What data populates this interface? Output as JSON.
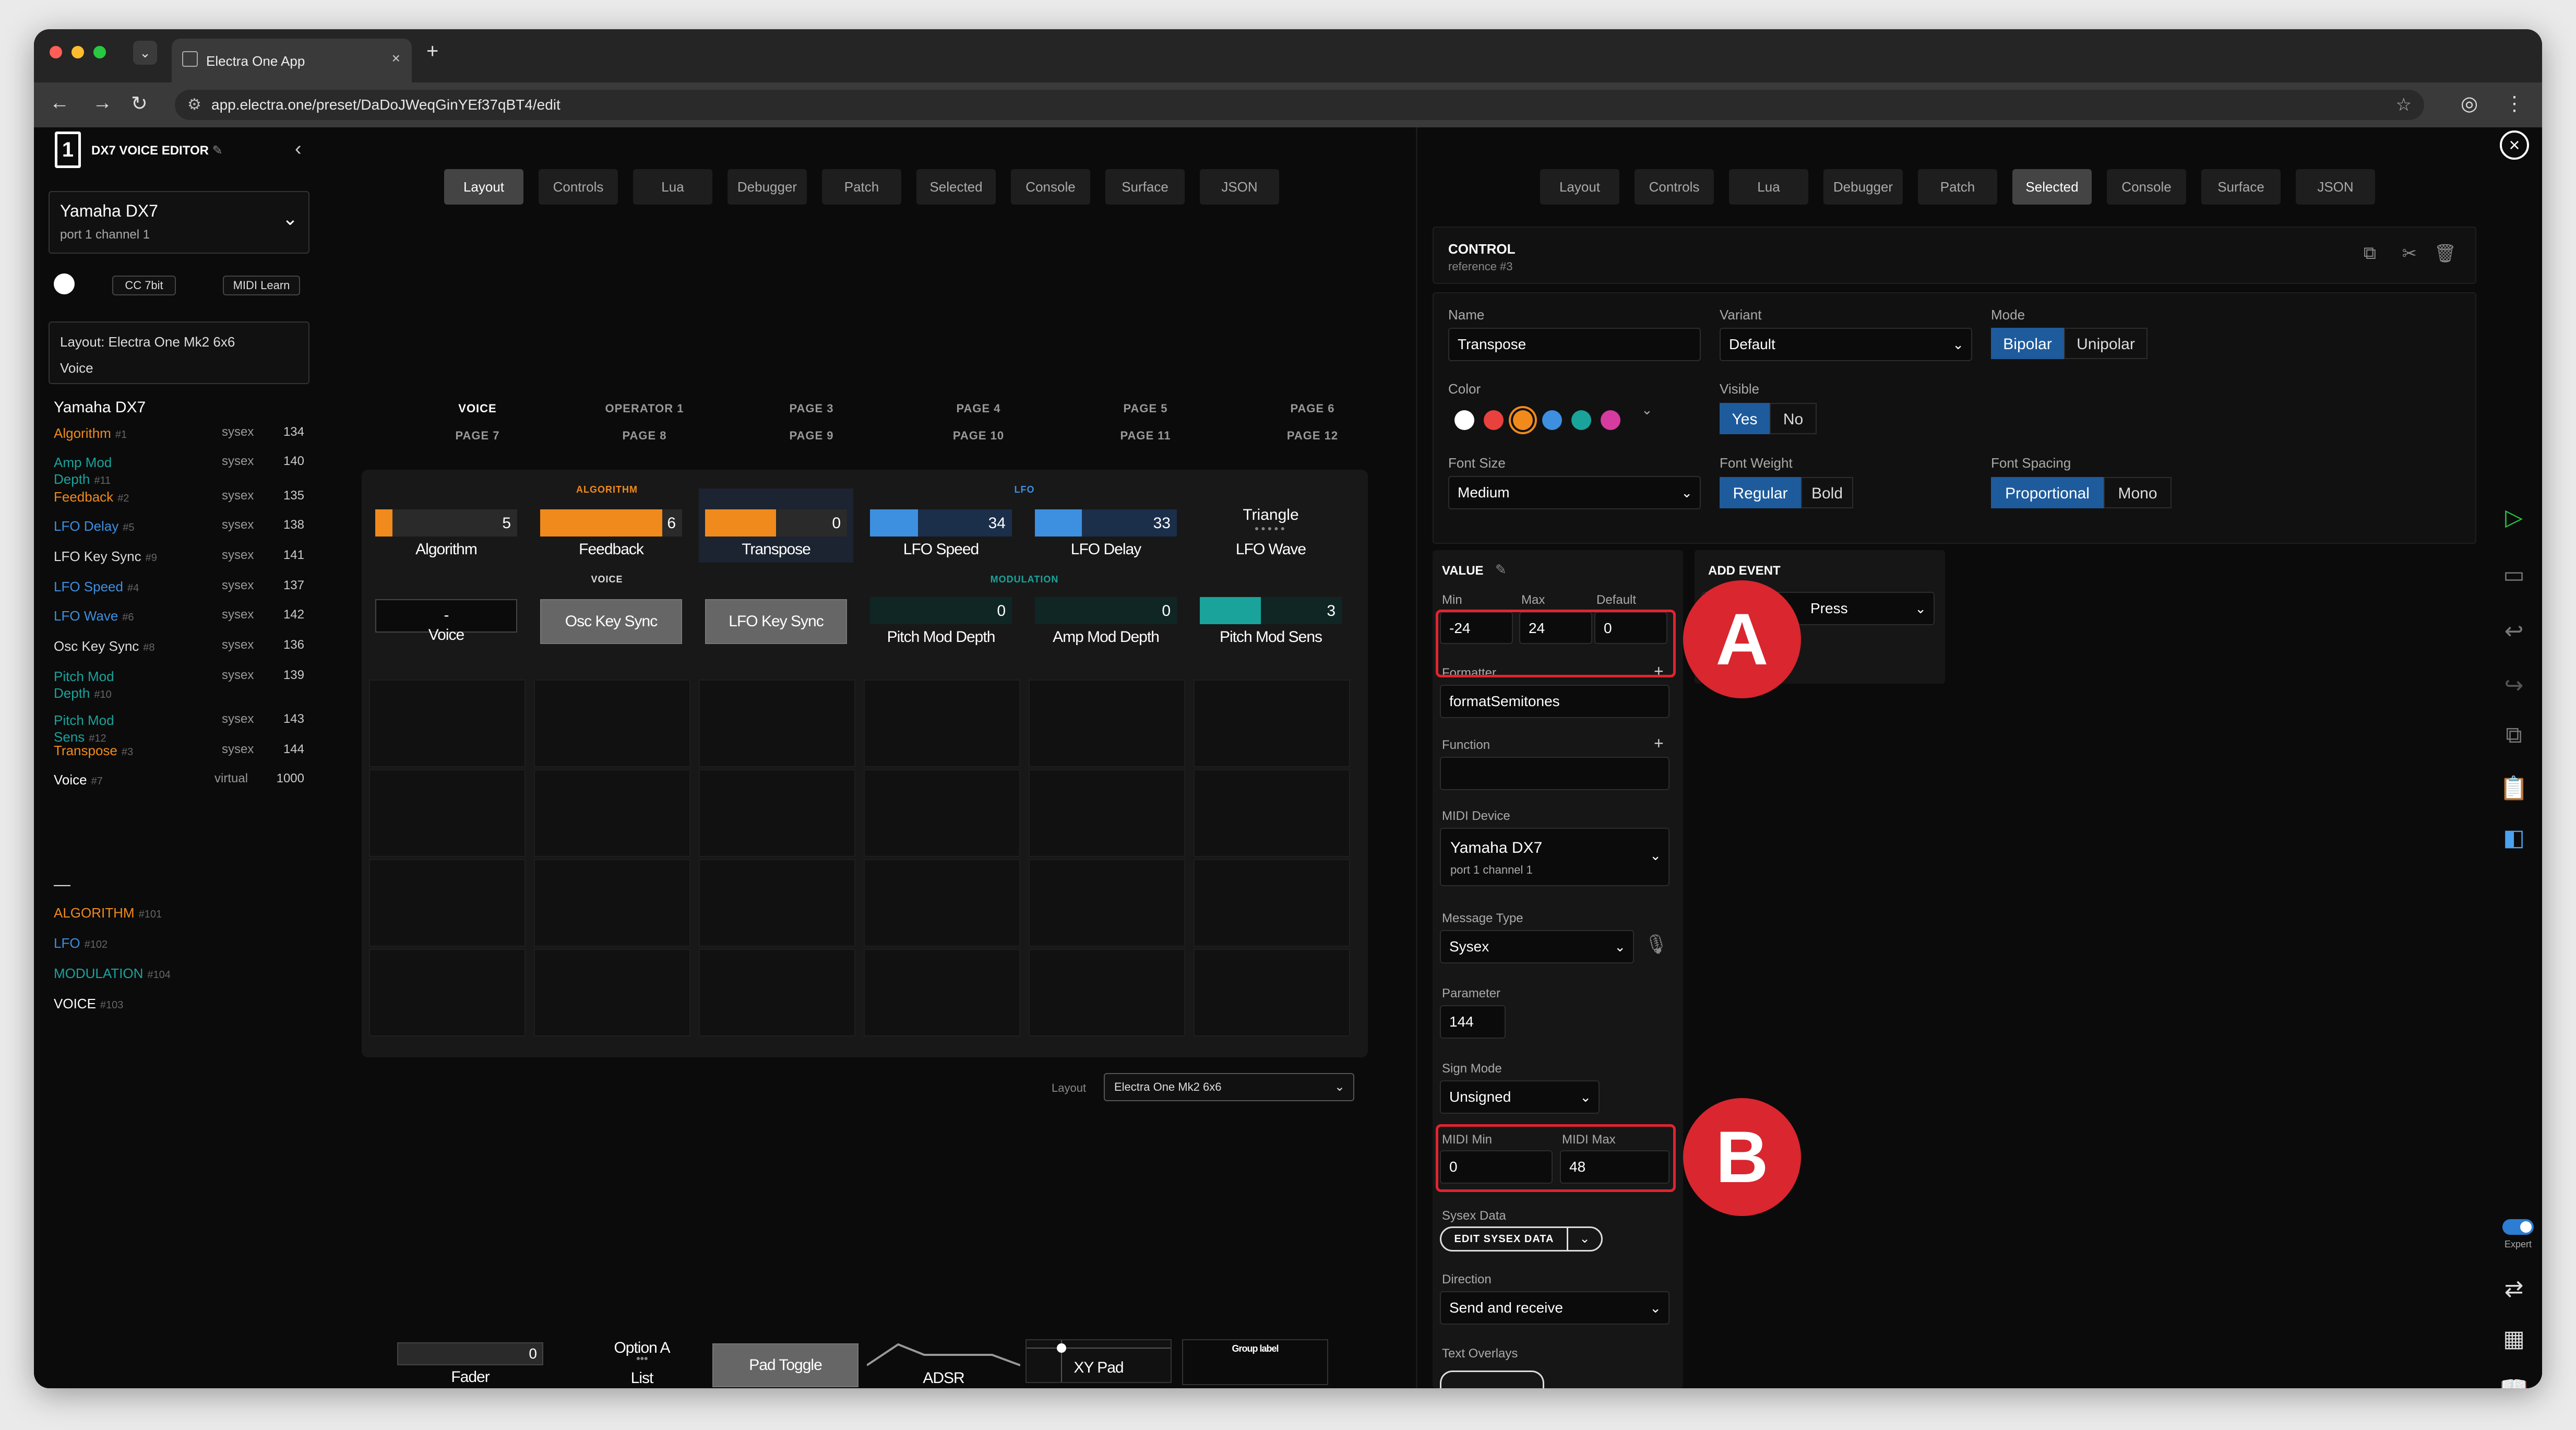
{
  "browser": {
    "tab_title": "Electra One App",
    "tab_close": "×",
    "new_tab": "+",
    "url": "app.electra.one/preset/DaDoJWeqGinYEf37qBT4/edit",
    "tune_icon": "⚙",
    "star_icon": "☆",
    "profile_icon": "◎",
    "menu_icon": "⋮",
    "back_icon": "←",
    "forward_icon": "→",
    "reload_icon": "↻",
    "tab_dropdown": "⌄"
  },
  "sidebar": {
    "logo": "1",
    "title": "DX7 VOICE EDITOR",
    "edit_icon": "✎",
    "collapse_icon": "‹",
    "device_name": "Yamaha DX7",
    "device_port": "port 1 channel 1",
    "device_chevron": "⌄",
    "cc_label": "CC 7bit",
    "midi_learn_label": "MIDI Learn",
    "layout_label": "Layout: Electra One Mk2 6x6",
    "layout_sub": "Voice",
    "controls_title": "Yamaha DX7",
    "controls": [
      {
        "name": "Algorithm",
        "ref": "#1",
        "type": "sysex",
        "param": "134",
        "color": "#f08a1c"
      },
      {
        "name": "Amp Mod Depth",
        "ref": "#11",
        "type": "sysex",
        "param": "140",
        "color": "#1aa39b"
      },
      {
        "name": "Feedback",
        "ref": "#2",
        "type": "sysex",
        "param": "135",
        "color": "#f08a1c"
      },
      {
        "name": "LFO Delay",
        "ref": "#5",
        "type": "sysex",
        "param": "138",
        "color": "#3d8fe0"
      },
      {
        "name": "LFO Key Sync",
        "ref": "#9",
        "type": "sysex",
        "param": "141",
        "color": "#dddddd"
      },
      {
        "name": "LFO Speed",
        "ref": "#4",
        "type": "sysex",
        "param": "137",
        "color": "#3d8fe0"
      },
      {
        "name": "LFO Wave",
        "ref": "#6",
        "type": "sysex",
        "param": "142",
        "color": "#3d8fe0"
      },
      {
        "name": "Osc Key Sync",
        "ref": "#8",
        "type": "sysex",
        "param": "136",
        "color": "#dddddd"
      },
      {
        "name": "Pitch Mod Depth",
        "ref": "#10",
        "type": "sysex",
        "param": "139",
        "color": "#1aa39b"
      },
      {
        "name": "Pitch Mod Sens",
        "ref": "#12",
        "type": "sysex",
        "param": "143",
        "color": "#1aa39b"
      },
      {
        "name": "Transpose",
        "ref": "#3",
        "type": "sysex",
        "param": "144",
        "color": "#f08a1c"
      },
      {
        "name": "Voice",
        "ref": "#7",
        "type": "virtual",
        "param": "1000",
        "color": "#ffffff"
      }
    ],
    "separator": "—",
    "groups": [
      {
        "name": "ALGORITHM",
        "ref": "#101",
        "color": "#f08a1c"
      },
      {
        "name": "LFO",
        "ref": "#102",
        "color": "#3d8fe0"
      },
      {
        "name": "MODULATION",
        "ref": "#104",
        "color": "#1aa39b"
      },
      {
        "name": "VOICE",
        "ref": "#103",
        "color": "#ffffff"
      }
    ]
  },
  "tabs": [
    "Layout",
    "Controls",
    "Lua",
    "Debugger",
    "Patch",
    "Selected",
    "Console",
    "Surface",
    "JSON"
  ],
  "left_active_tab": "Layout",
  "right_active_tab": "Selected",
  "pages_row1": [
    "VOICE",
    "OPERATOR 1",
    "PAGE 3",
    "PAGE 4",
    "PAGE 5",
    "PAGE 6"
  ],
  "pages_row2": [
    "PAGE 7",
    "PAGE 8",
    "PAGE 9",
    "PAGE 10",
    "PAGE 11",
    "PAGE 12"
  ],
  "device_groups": {
    "algorithm": "ALGORITHM",
    "lfo": "LFO",
    "voice": "VOICE",
    "modulation": "MODULATION"
  },
  "device_controls": {
    "algorithm": {
      "label": "Algorithm",
      "value": "5",
      "level": 0.12
    },
    "feedback": {
      "label": "Feedback",
      "value": "6",
      "level": 0.86
    },
    "transpose": {
      "label": "Transpose",
      "value": "0",
      "level": 0.5
    },
    "lfo_speed": {
      "label": "LFO Speed",
      "value": "34",
      "level": 0.34
    },
    "lfo_delay": {
      "label": "LFO Delay",
      "value": "33",
      "level": 0.33
    },
    "lfo_wave": {
      "label": "LFO Wave",
      "value": "Triangle"
    },
    "voice": {
      "label": "Voice",
      "value": "-"
    },
    "osc_key_sync": {
      "label": "Osc Key Sync"
    },
    "lfo_key_sync": {
      "label": "LFO Key Sync"
    },
    "pitch_mod_depth": {
      "label": "Pitch Mod Depth",
      "value": "0"
    },
    "amp_mod_depth": {
      "label": "Amp Mod Depth",
      "value": "0"
    },
    "pitch_mod_sens": {
      "label": "Pitch Mod Sens",
      "value": "3",
      "level": 0.43
    }
  },
  "layout_select": {
    "label": "Layout",
    "value": "Electra One Mk2 6x6"
  },
  "palette": {
    "fader": {
      "label": "Fader",
      "value": "0"
    },
    "option": {
      "label": "List",
      "value": "Option A"
    },
    "pad_toggle": {
      "label": "Pad Toggle"
    },
    "adsr": {
      "label": "ADSR"
    },
    "xy_pad": {
      "label": "XY Pad"
    },
    "group_label": {
      "label": "Group label"
    }
  },
  "control_panel": {
    "title": "CONTROL",
    "subtitle": "reference #3",
    "close_icon": "×",
    "name_label": "Name",
    "name_value": "Transpose",
    "variant_label": "Variant",
    "variant_value": "Default",
    "mode_label": "Mode",
    "mode_options": [
      "Bipolar",
      "Unipolar"
    ],
    "mode_selected": "Bipolar",
    "color_label": "Color",
    "colors": [
      "#ffffff",
      "#e8413e",
      "#f08a1c",
      "#3d8fe0",
      "#1aa39b",
      "#d63ba0"
    ],
    "selected_color": "#f08a1c",
    "visible_label": "Visible",
    "visible_options": [
      "Yes",
      "No"
    ],
    "visible_selected": "Yes",
    "font_size_label": "Font Size",
    "font_size_value": "Medium",
    "font_weight_label": "Font Weight",
    "font_weight_options": [
      "Regular",
      "Bold"
    ],
    "font_weight_selected": "Regular",
    "font_spacing_label": "Font Spacing",
    "font_spacing_options": [
      "Proportional",
      "Mono"
    ],
    "font_spacing_selected": "Proportional"
  },
  "value_panel": {
    "title": "VALUE",
    "min_label": "Min",
    "min_value": "-24",
    "max_label": "Max",
    "max_value": "24",
    "default_label": "Default",
    "default_value": "0",
    "formatter_label": "Formatter",
    "formatter_value": "formatSemitones",
    "function_label": "Function",
    "function_value": "",
    "midi_device_label": "MIDI Device",
    "midi_device_value": "Yamaha DX7",
    "midi_device_port": "port 1 channel 1",
    "message_type_label": "Message Type",
    "message_type_value": "Sysex",
    "parameter_label": "Parameter",
    "parameter_value": "144",
    "sign_mode_label": "Sign Mode",
    "sign_mode_value": "Unsigned",
    "midi_min_label": "MIDI Min",
    "midi_min_value": "0",
    "midi_max_label": "MIDI Max",
    "midi_max_value": "48",
    "sysex_label": "Sysex Data",
    "sysex_button": "EDIT SYSEX DATA",
    "direction_label": "Direction",
    "direction_value": "Send and receive",
    "overlays_label": "Text Overlays"
  },
  "event_panel": {
    "title": "ADD EVENT",
    "value": "Press"
  },
  "annotations": {
    "a": "A",
    "b": "B"
  },
  "rail": {
    "expert_label": "Expert"
  }
}
